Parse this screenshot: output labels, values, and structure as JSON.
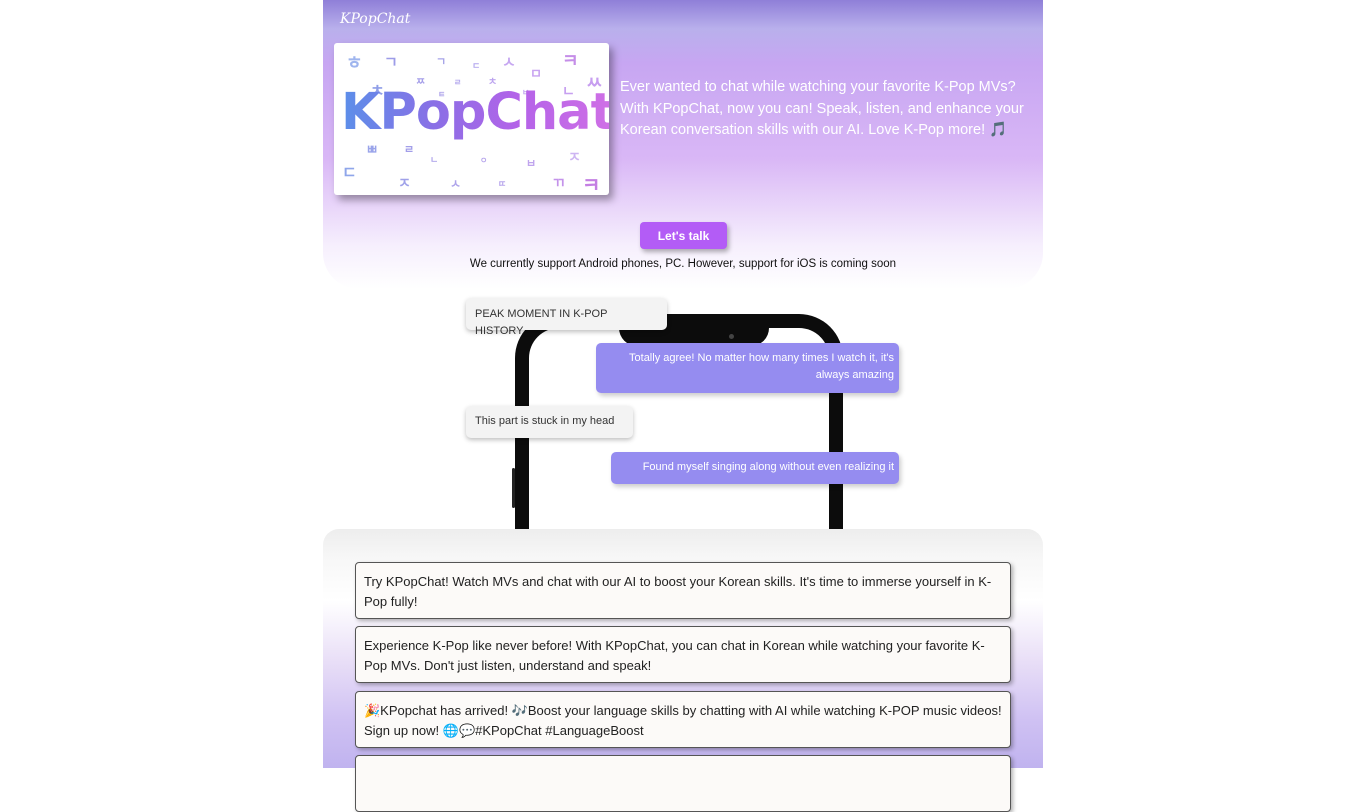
{
  "brand": {
    "name": "KPopChat"
  },
  "hero": {
    "logo_text": "KPopChat",
    "intro": "Ever wanted to chat while watching your favorite K-Pop MVs? With KPopChat, now you can! Speak, listen, and enhance your Korean conversation skills with our AI. Love K-Pop more! 🎵",
    "cta_label": "Let's talk",
    "support_note": "We currently support Android phones, PC. However, support for iOS is coming soon",
    "jamo": [
      "ㅎ",
      "ㄱ",
      "ㄱ",
      "ㄷ",
      "ㅅ",
      "ㅋ",
      "ㅊ",
      "ㅉ",
      "ㅌ",
      "ㄹ",
      "ㅊ",
      "ㅁ",
      "ㅆ",
      "ㄴ",
      "ㅂ",
      "ㅃ",
      "ㄹ",
      "ㄷ",
      "ㄴ",
      "ㅇ",
      "ㅂ",
      "ㅈ",
      "ㅈ",
      "ㅅ",
      "ㄸ",
      "ㄲ",
      "ㅋ"
    ]
  },
  "chat": {
    "messages": [
      {
        "side": "left",
        "text": "PEAK MOMENT IN K-POP HISTORY"
      },
      {
        "side": "right",
        "text": "Totally agree! No matter how many times I watch it, it's always amazing"
      },
      {
        "side": "left",
        "text": "This part is stuck in my head"
      },
      {
        "side": "right",
        "text": "Found myself singing along without even realizing it"
      }
    ]
  },
  "cards": [
    "Try KPopChat! Watch MVs and chat with our AI to boost your Korean skills. It's time to immerse yourself in K-Pop fully!",
    "Experience K-Pop like never before! With KPopChat, you can chat in Korean while watching your favorite K-Pop MVs. Don't just listen, understand and speak!",
    "🎉KPopchat has arrived! 🎶Boost your language skills by chatting with AI while watching K-POP music videos! Sign up now! 🌐💬#KPopChat #LanguageBoost"
  ],
  "colors": {
    "accent": "#b35cf6",
    "bubble_right": "#958cf0",
    "bubble_left": "#f3f3f3"
  }
}
